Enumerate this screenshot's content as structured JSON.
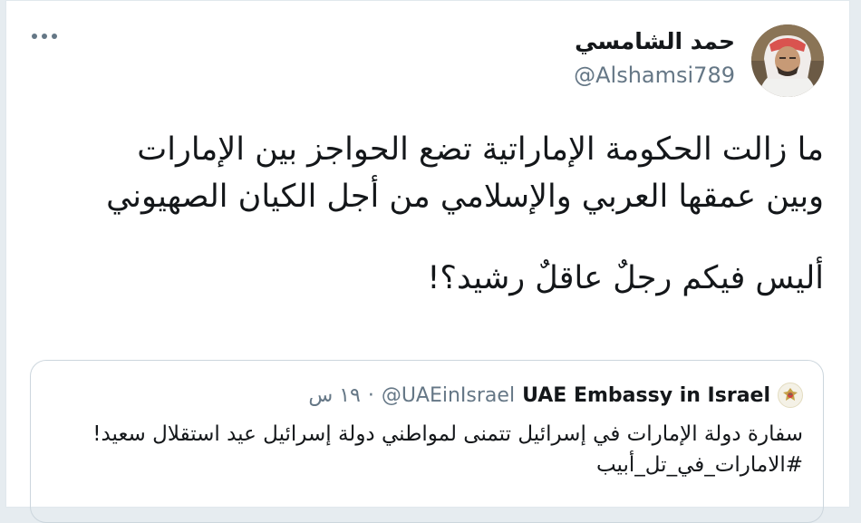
{
  "author": {
    "name": "حمد الشامسي",
    "handle": "@Alshamsi789"
  },
  "tweet": {
    "paragraph1": "ما زالت الحكومة الإماراتية تضع الحواجز بين الإمارات وبين عمقها العربي والإسلامي من أجل الكيان الصهيوني",
    "paragraph2": "أليس فيكم رجلٌ عاقلٌ رشيد؟!"
  },
  "quoted_tweet": {
    "name": "UAE Embassy in Israel",
    "handle": "@UAEinIsrael",
    "separator": "·",
    "time": "١٩ س",
    "text": "سفارة دولة الإمارات في إسرائيل تتمنى لمواطني دولة إسرائيل عيد استقلال سعيد! #الامارات_في_تل_أبيب",
    "icon": "uae-emblem-icon"
  },
  "icons": {
    "more": "more-options-icon",
    "avatar": "user-avatar"
  }
}
